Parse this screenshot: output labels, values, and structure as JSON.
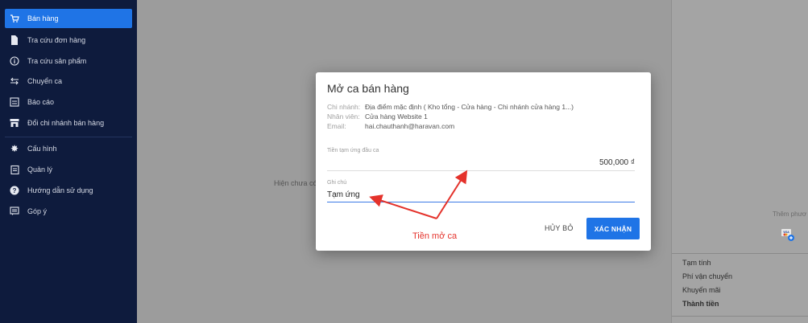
{
  "sidebar": {
    "items": [
      {
        "label": "Bán hàng",
        "icon": "cart-icon",
        "active": true
      },
      {
        "label": "Tra cứu đơn hàng",
        "icon": "document-icon"
      },
      {
        "label": "Tra cứu sản phẩm",
        "icon": "info-icon"
      },
      {
        "label": "Chuyển ca",
        "icon": "swap-icon"
      },
      {
        "label": "Báo cáo",
        "icon": "report-icon"
      },
      {
        "label": "Đổi chi nhánh bán hàng",
        "icon": "store-icon"
      },
      {
        "label": "Cấu hình",
        "icon": "gear-icon"
      },
      {
        "label": "Quản lý",
        "icon": "clipboard-icon"
      },
      {
        "label": "Hướng dẫn sử dụng",
        "icon": "help-icon"
      },
      {
        "label": "Góp ý",
        "icon": "feedback-icon"
      }
    ]
  },
  "main": {
    "empty_text": "Hiện chưa có"
  },
  "right_panel": {
    "add_payment": "Thêm phươ",
    "summary": {
      "subtotal": "Tạm tính",
      "shipping": "Phí vận chuyển",
      "discount": "Khuyến mãi",
      "total": "Thành tiền"
    }
  },
  "modal": {
    "title": "Mở ca bán hàng",
    "branch_label": "Chi nhánh:",
    "branch_value": "Địa điểm mặc định ( Kho tổng - Cửa hàng - Chi nhánh cửa hàng 1...)",
    "staff_label": "Nhân viên:",
    "staff_value": "Cửa hàng Website 1",
    "email_label": "Email:",
    "email_value": "hai.chauthanh@haravan.com",
    "advance_label": "Tiền tạm ứng đầu ca",
    "advance_value": "500,000 ₫",
    "note_label": "Ghi chú",
    "note_value": "Tạm ứng",
    "cancel_label": "HỦY BỎ",
    "confirm_label": "XÁC NHẬN"
  },
  "annotation": {
    "text": "Tiền mở ca",
    "color": "#e4322b"
  },
  "colors": {
    "sidebar_bg": "#0e1b3d",
    "accent": "#1f74e6"
  }
}
